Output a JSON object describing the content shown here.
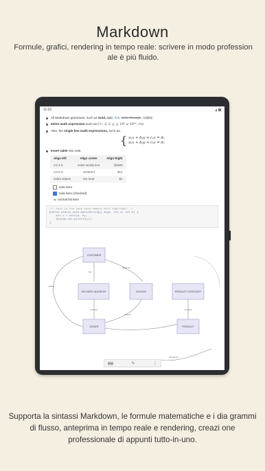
{
  "header": {
    "title": "Markdown",
    "subtitle": "Formule, grafici, rendering in tempo reale: scrivere in modo profession ale è più fluido."
  },
  "footer": {
    "caption": "Supporta la sintassi Markdown, le formule matematiche e i dia grammi di flusso, anteprima in tempo reale e rendering, creazi one professionale di appunti tutto-in-uno."
  },
  "statusbar": {
    "time": "11:02"
  },
  "doc": {
    "line1_prefix": "All Markdown grammars, such as",
    "line1_bold": "bold,",
    "line1_italic": "italic,",
    "line1_link": "link,",
    "line1_strike": "strike through,",
    "line1_code": "code1",
    "line2_bold": "Inline math expression",
    "line2_text": "such as",
    "line2_math": "C₁ⁿ, ā, x̃, ẏ, ẏ, 10³ ≠ 10⁶ᵇ, (ᵃ⁄ᵦ)",
    "line3_prefix": "Also, the",
    "line3_bold": "single line math expressions,",
    "line3_suffix": "such as,",
    "math_row1": "a₁x + b₁y + c₁z = d₁",
    "math_row2": "a₂x + b₂y + c₂z = d₂",
    "line4_bold": "Insert table",
    "line4_suffix": "into note,",
    "table": {
      "headers": [
        "Align left",
        "Align center",
        "Align Right"
      ],
      "rows": [
        [
          "col 3 is",
          "some wordy text",
          "$1600"
        ],
        [
          "col 2 is",
          "centered",
          "$12"
        ],
        [
          "zebra stripes",
          "are neat",
          "$1"
        ]
      ]
    },
    "tasks": [
      {
        "label": "todo item",
        "checked": false
      },
      {
        "label": "todo item (checked)",
        "checked": true
      }
    ],
    "normal_item": "normal list item",
    "code": [
      "/** this is the Java code sample with highlight. */",
      "public static void main(String[] args, int a, int b) {",
      "    int c = calc(a, b);",
      "    System.out.println(c);",
      "}"
    ]
  },
  "diagram": {
    "nodes": {
      "customer": "CUSTOMER",
      "delivery": "DELIVERY ADDRESS",
      "invoice": "INVOICE",
      "product_category": "PRODUCT-CATEGORY",
      "order": "ORDER",
      "product": "PRODUCT"
    },
    "edges": {
      "places": "places",
      "has": "has",
      "liable_for": "liable for",
      "receives": "receives",
      "covers": "covers",
      "contains": "contains",
      "categorize": "categorize"
    }
  },
  "colors": {
    "background": "#f5efe1",
    "tablet": "#2b2d31",
    "node_fill": "#e6e6f6",
    "node_stroke": "#9a9ac8"
  },
  "icons": [
    "menu-icon",
    "edit-icon",
    "more-icon"
  ]
}
